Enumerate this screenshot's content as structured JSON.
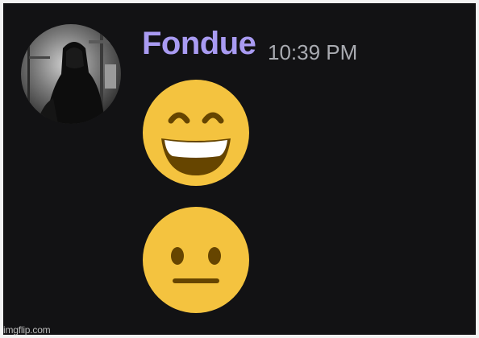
{
  "message": {
    "author": {
      "username": "Fondue",
      "username_color": "#a99bf2",
      "avatar": "user-avatar-dark-figure"
    },
    "timestamp": "10:39 PM",
    "timestamp_color": "#a9abb1",
    "emojis": [
      {
        "name": "grinning-face-with-smiling-eyes",
        "icon": "grin-emoji-icon"
      },
      {
        "name": "neutral-face",
        "icon": "neutral-face-emoji-icon"
      }
    ]
  },
  "watermark": "imgflip.com",
  "colors": {
    "background": "#121214",
    "emoji_yellow": "#f4c33f",
    "emoji_features": "#664500"
  }
}
